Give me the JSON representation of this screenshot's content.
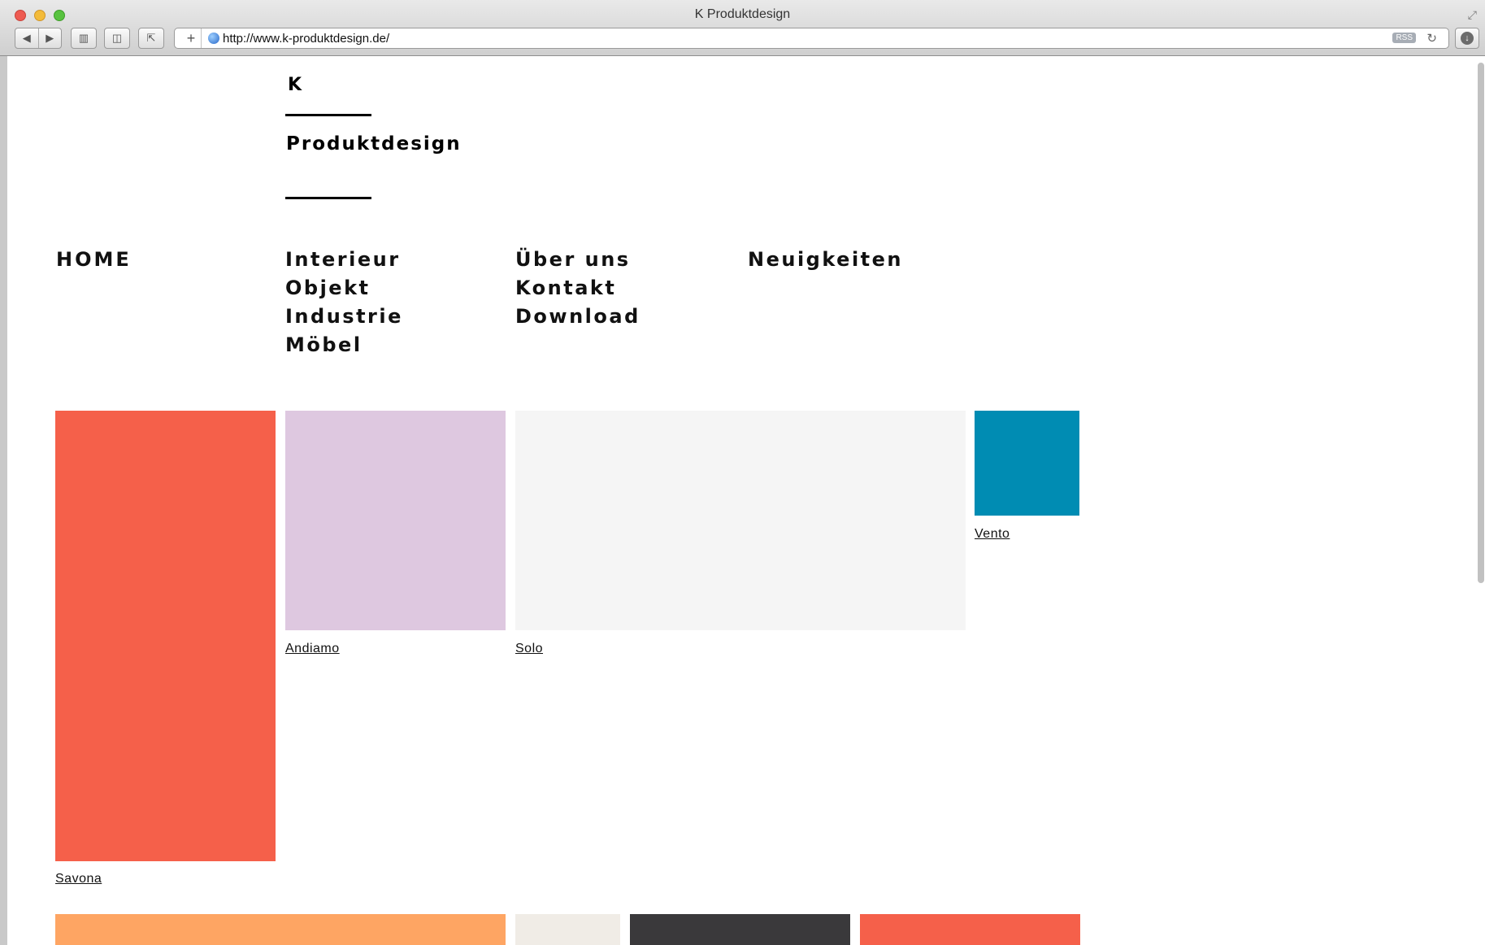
{
  "browser": {
    "window_title": "K Produktdesign",
    "url": "http://www.k-produktdesign.de/",
    "rss_label": "RSS",
    "icons": [
      "close-icon",
      "minimize-icon",
      "zoom-icon",
      "back-icon",
      "forward-icon",
      "bookmarks-icon",
      "reader-icon",
      "share-icon",
      "add-icon",
      "globe-icon",
      "rss-icon",
      "reload-icon",
      "download-icon",
      "fullscreen-icon"
    ]
  },
  "logo": {
    "letter": "K",
    "wordmark": "Produktdesign"
  },
  "nav": {
    "home": "HOME",
    "col2": [
      "Interieur",
      "Objekt",
      "Industrie",
      "Möbel"
    ],
    "col3": [
      "Über uns",
      "Kontakt",
      "Download"
    ],
    "news": "Neuigkeiten"
  },
  "tiles": {
    "savona": {
      "caption": "Savona",
      "color": "#f5604a"
    },
    "andiamo": {
      "caption": "Andiamo",
      "color": "#dec8e0"
    },
    "solo": {
      "caption": "Solo",
      "color": "#f5f5f5"
    },
    "vento": {
      "caption": "Vento",
      "color": "#008cb3"
    },
    "row2": [
      {
        "color": "#fea563"
      },
      {
        "color": "#f0ece6"
      },
      {
        "color": "#3a393b"
      },
      {
        "color": "#f5604a"
      }
    ]
  }
}
